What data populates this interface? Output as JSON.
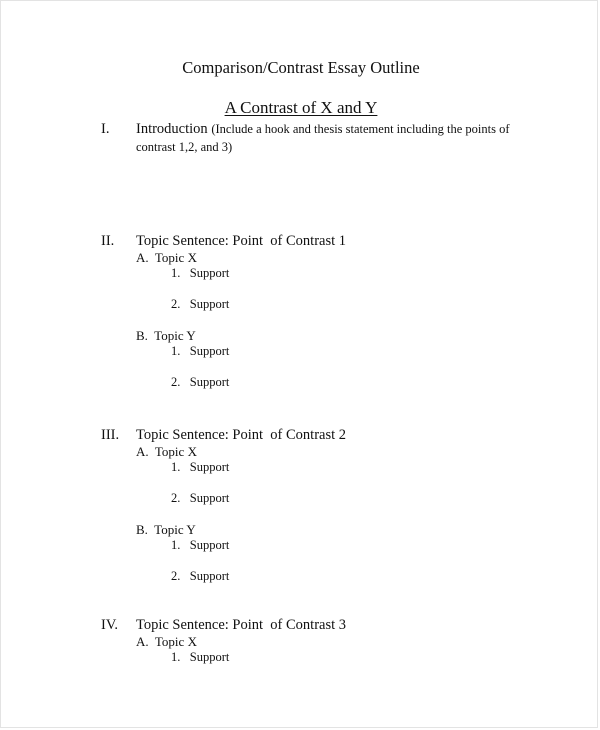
{
  "document": {
    "title": "Comparison/Contrast Essay Outline",
    "subtitle": "A Contrast of X and Y",
    "sections": [
      {
        "numeral": "I.",
        "heading": "Introduction",
        "note": "(Include a hook and thesis statement including the points of",
        "note_cont": "contrast 1,2, and 3)"
      },
      {
        "numeral": "II.",
        "heading": "Topic Sentence: Point  of Contrast 1",
        "topics": [
          {
            "label": "A.  Topic X",
            "supports": [
              "1.   Support",
              "2.   Support"
            ]
          },
          {
            "label": "B.  Topic Y",
            "supports": [
              "1.   Support",
              "2.   Support"
            ]
          }
        ]
      },
      {
        "numeral": "III.",
        "heading": "Topic Sentence: Point  of Contrast 2",
        "topics": [
          {
            "label": "A.  Topic X",
            "supports": [
              "1.   Support",
              "2.   Support"
            ]
          },
          {
            "label": "B.  Topic Y",
            "supports": [
              "1.   Support",
              "2.   Support"
            ]
          }
        ]
      },
      {
        "numeral": "IV.",
        "heading": "Topic Sentence: Point  of Contrast 3",
        "topics": [
          {
            "label": "A.  Topic X",
            "supports": [
              "1.   Support"
            ]
          }
        ]
      }
    ]
  }
}
